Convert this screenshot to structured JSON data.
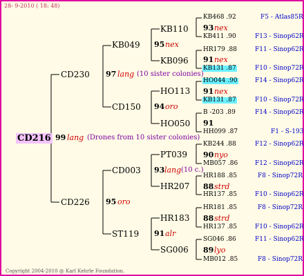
{
  "header": {
    "date": "28-  9-2010 ( 18: 48)"
  },
  "footer": {
    "copyright": "Copyright 2004-2010 @ Karl Kehrle Foundation."
  },
  "tree": {
    "root": {
      "id": "CD216",
      "num": "99",
      "queen": "lang",
      "note": "(Drones from 10 sister colonies)"
    },
    "g1": [
      {
        "id": "CD230",
        "num": "97",
        "queen": "lang",
        "note": "(10 sister colonies)"
      },
      {
        "id": "CD226",
        "num": "95",
        "queen": "oro",
        "note": ""
      }
    ],
    "g2": [
      {
        "id": "KB049",
        "num": "95",
        "queen": "nex",
        "note": ""
      },
      {
        "id": "CD150",
        "num": "94",
        "queen": "oro",
        "note": ""
      },
      {
        "id": "CD003",
        "num": "93",
        "queen": "lang",
        "note": "(10 c.)"
      },
      {
        "id": "ST119",
        "num": "91",
        "queen": "alr",
        "note": ""
      }
    ],
    "g3": [
      {
        "id": "KB110",
        "num": "93",
        "queen": "nex"
      },
      {
        "id": "KB096",
        "num": "91",
        "queen": "nex"
      },
      {
        "id": "HO113",
        "num": "91",
        "queen": "nex"
      },
      {
        "id": "HO050",
        "num": "91",
        "queen": ""
      },
      {
        "id": "PT039",
        "num": "90",
        "queen": "nyo"
      },
      {
        "id": "HR207",
        "num": "88",
        "queen": "strd"
      },
      {
        "id": "HR183",
        "num": "88",
        "queen": "strd"
      },
      {
        "id": "SG006",
        "num": "89",
        "queen": "lyo"
      }
    ],
    "g4": [
      {
        "id": "KB468 .92",
        "rel": "F5 - Atlas85R"
      },
      {
        "id": "KB411 .90",
        "rel": "F13 - Sinop62R"
      },
      {
        "id": "HR179 .88",
        "rel": "F11 - Sinop62R"
      },
      {
        "id": "KB131 .87",
        "rel": "F10 - Sinop72R"
      },
      {
        "id": "HO044 .90",
        "rel": "F14 - Sinop62R"
      },
      {
        "id": "KB131 .87",
        "rel": "F10 - Sinop72R"
      },
      {
        "id": "B -203 .89",
        "rel": "F14 - Sinop62R"
      },
      {
        "id": "HH099 .87",
        "rel": "F1 - S-193"
      },
      {
        "id": "KB244 .88",
        "rel": "F12 - Sinop62R"
      },
      {
        "id": "MB057 .86",
        "rel": "F12 - Sinop62R"
      },
      {
        "id": "HR188 .85",
        "rel": "F8 - Sinop72R"
      },
      {
        "id": "HR137 .85",
        "rel": "F10 - Sinop62R"
      },
      {
        "id": "HR181 .85",
        "rel": "F8 - Sinop72R"
      },
      {
        "id": "HR137 .85",
        "rel": "F10 - Sinop62R"
      },
      {
        "id": "SG046 .86",
        "rel": "F11 - Sinop62R"
      },
      {
        "id": "MB012 .85",
        "rel": "F8 - Sinop72R"
      }
    ]
  }
}
